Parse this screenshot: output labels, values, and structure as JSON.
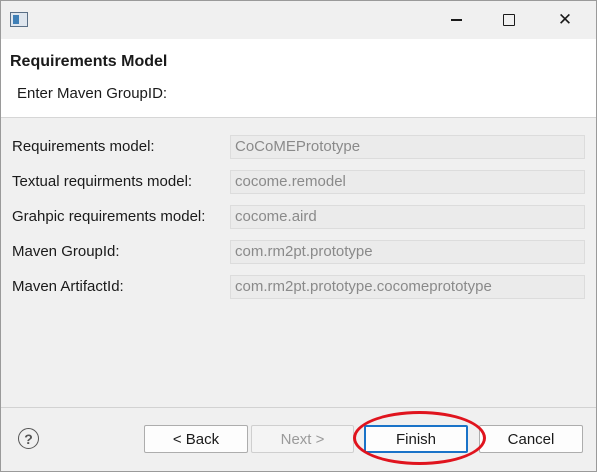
{
  "window": {
    "minimize_glyph": "",
    "close_glyph": "✕"
  },
  "header": {
    "title": "Requirements Model",
    "message": "Enter Maven GroupID:"
  },
  "form": {
    "fields": [
      {
        "label": "Requirements model:",
        "value": "CoCoMEPrototype"
      },
      {
        "label": "Textual requirments model:",
        "value": "cocome.remodel"
      },
      {
        "label": "Grahpic requirements model:",
        "value": "cocome.aird"
      },
      {
        "label": "Maven GroupId:",
        "value": "com.rm2pt.prototype"
      },
      {
        "label": "Maven ArtifactId:",
        "value": "com.rm2pt.prototype.cocomeprototype"
      }
    ]
  },
  "footer": {
    "help_glyph": "?",
    "back_label": "< Back",
    "next_label": "Next >",
    "finish_label": "Finish",
    "cancel_label": "Cancel"
  },
  "colors": {
    "annotation_ellipse": "#e0141e",
    "default_button_border": "#1a73c8"
  },
  "icons": [
    "app-window-icon",
    "minimize-icon",
    "maximize-icon",
    "close-icon",
    "help-icon"
  ]
}
